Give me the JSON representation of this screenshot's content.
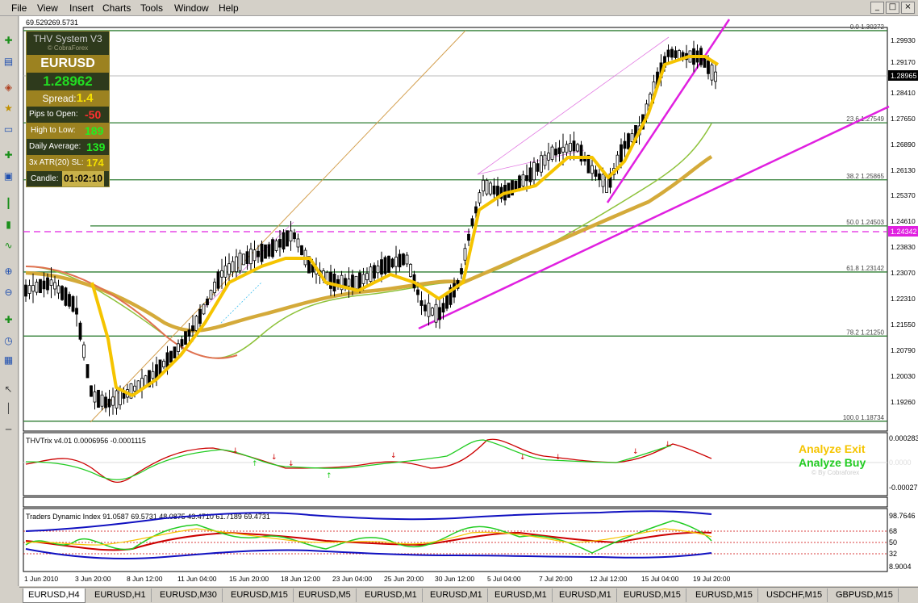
{
  "menu": [
    "File",
    "View",
    "Insert",
    "Charts",
    "Tools",
    "Window",
    "Help"
  ],
  "window_buttons": [
    "_",
    "□",
    "×"
  ],
  "toolbar_icons": [
    "new-chart-icon",
    "profiles-icon",
    "market-watch-icon",
    "navigator-icon",
    "terminal-icon",
    "tester-icon",
    "crosshair-icon",
    "line-icon",
    "zoom-in-icon",
    "zoom-out-icon",
    "add-indicator-icon",
    "period-icon",
    "template-icon"
  ],
  "chart": {
    "corner_readout": "69.529269.5731",
    "price_labels": [
      "1.29930",
      "1.29170",
      "1.28965",
      "1.28410",
      "1.27650",
      "1.26890",
      "1.26130",
      "1.25370",
      "1.24610",
      "1.24342",
      "1.23830",
      "1.23070",
      "1.22310",
      "1.21550",
      "1.20790",
      "1.20030",
      "1.19260"
    ],
    "current_price": "1.28965",
    "dashed_level": "1.24342",
    "fib_levels": [
      {
        "label": "0.0 1.30272",
        "price": 1.30272
      },
      {
        "label": "23.6 1.27549",
        "price": 1.27549
      },
      {
        "label": "38.2 1.25865",
        "price": 1.25865
      },
      {
        "label": "50.0 1.24503",
        "price": 1.24503
      },
      {
        "label": "61.8 1.23142",
        "price": 1.23142
      },
      {
        "label": "78.2 1.21250",
        "price": 1.2125
      },
      {
        "label": "100.0 1.18734",
        "price": 1.18734
      }
    ],
    "time_labels": [
      "1 Jun 2010",
      "3 Jun 20:00",
      "8 Jun 12:00",
      "11 Jun 04:00",
      "15 Jun 20:00",
      "18 Jun 12:00",
      "23 Jun 04:00",
      "25 Jun 20:00",
      "30 Jun 12:00",
      "5 Jul 04:00",
      "7 Jul 20:00",
      "12 Jul 12:00",
      "15 Jul 04:00",
      "19 Jul 20:00"
    ],
    "colors": {
      "fib": "#2e7d32",
      "magenta": "#e020e0",
      "gold": "#d4aa3a",
      "yellow": "#f5c400",
      "lime": "#8ec23a",
      "red": "#cc0000",
      "green": "#22cc22",
      "blue": "#1010c0"
    }
  },
  "info_panel": {
    "title": "THV System V3",
    "subtitle": "© CobraForex",
    "symbol": "EURUSD",
    "price": "1.28962",
    "spread_label": "Spread:",
    "spread_value": "1.4",
    "pips_label": "Pips to Open:",
    "pips_value": "-50",
    "hl_label": "High to Low:",
    "hl_value": "189",
    "daily_label": "Daily Average:",
    "daily_value": "139",
    "atr_label": "3x ATR(20) SL:",
    "atr_value": "174",
    "candle_label": "Candle:",
    "candle_value": "01:02:10"
  },
  "trix": {
    "title": "THVTrix v4.01 0.0006956 -0.0001115",
    "labels": [
      "0.000283",
      "0.0000",
      "-0.00027"
    ],
    "analyze_exit": "Analyze Exit",
    "analyze_buy": "Analyze Buy",
    "credit": "© By Cobraforex"
  },
  "tdi": {
    "title": "Traders Dynamic Index 91.0587 69.5731 48.0875 43.4710 61.7189 69.4731",
    "labels": [
      "98.7646",
      "68",
      "50",
      "32",
      "8.9004"
    ]
  },
  "tabs": [
    "EURUSD,H4",
    "EURUSD,H1",
    "EURUSD,M30",
    "EURUSD,M15",
    "EURUSD,M5",
    "EURUSD,M1",
    "EURUSD,M1",
    "EURUSD,M1",
    "EURUSD,M1",
    "EURUSD,M15",
    "EURUSD,M15",
    "USDCHF,M15",
    "GBPUSD,M15"
  ]
}
